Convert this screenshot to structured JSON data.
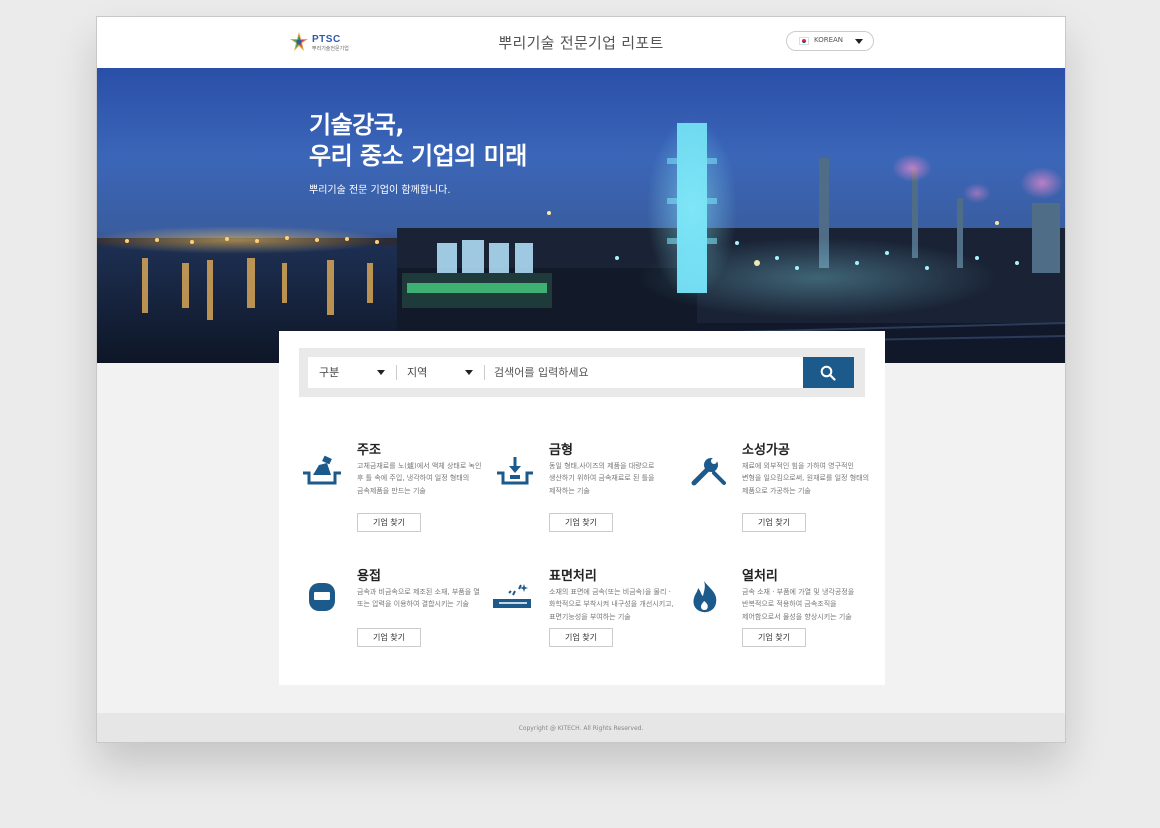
{
  "header": {
    "logo_text": "PTSC",
    "logo_sub": "뿌리기술전문기업",
    "title": "뿌리기술 전문기업 리포트",
    "language": "KOREAN"
  },
  "hero": {
    "title_line1": "기술강국,",
    "title_line2": "우리 중소 기업의 미래",
    "subtitle": "뿌리기술 전문 기업이 함께합니다."
  },
  "search": {
    "category_label": "구분",
    "region_label": "지역",
    "placeholder": "검색어를 입력하세요"
  },
  "categories": [
    {
      "name": "주조",
      "icon": "casting-icon",
      "desc": "고체금재료를 노(爐)에서 액체 상태로 녹인 후 틀 속에 주입, 냉각하여 일정 형태의 금속제품을 만드는 기술",
      "button": "기업 찾기"
    },
    {
      "name": "금형",
      "icon": "mold-icon",
      "desc": "동일 형태,사이즈의 제품을 대량으로 생산하기 위하여 금속재료로 된 틀을 제작하는 기술",
      "button": "기업 찾기"
    },
    {
      "name": "소성가공",
      "icon": "wrench-icon",
      "desc": "재료에 외부적인 힘을 가하여 영구적인 변형을 일으킴으로써, 원재료를 일정 형태의 제품으로 가공하는 기술",
      "button": "기업 찾기"
    },
    {
      "name": "용접",
      "icon": "welding-mask-icon",
      "desc": "금속과 비금속으로 제조된 소재, 부품을 열 또는 압력을 이용하여 결합시키는 기술",
      "button": "기업 찾기"
    },
    {
      "name": "표면처리",
      "icon": "surface-treatment-icon",
      "desc": "소재의 표면에 금속(또는 비금속)을 물리 · 화학적으로 부착시켜 내구성을 개선시키고, 표면기능성을 부여하는 기술",
      "button": "기업 찾기"
    },
    {
      "name": "열처리",
      "icon": "flame-icon",
      "desc": "금속 소재 · 부품에 가열 및 냉각공정을 반복적으로 적용하여 금속조직을 제어함으로서 물성을 향상시키는 기술",
      "button": "기업 찾기"
    }
  ],
  "footer": {
    "copyright": "Copyright @ KITECH. All Rights Reserved."
  },
  "colors": {
    "accent": "#1d5a8c",
    "icon": "#1d5a8c"
  }
}
